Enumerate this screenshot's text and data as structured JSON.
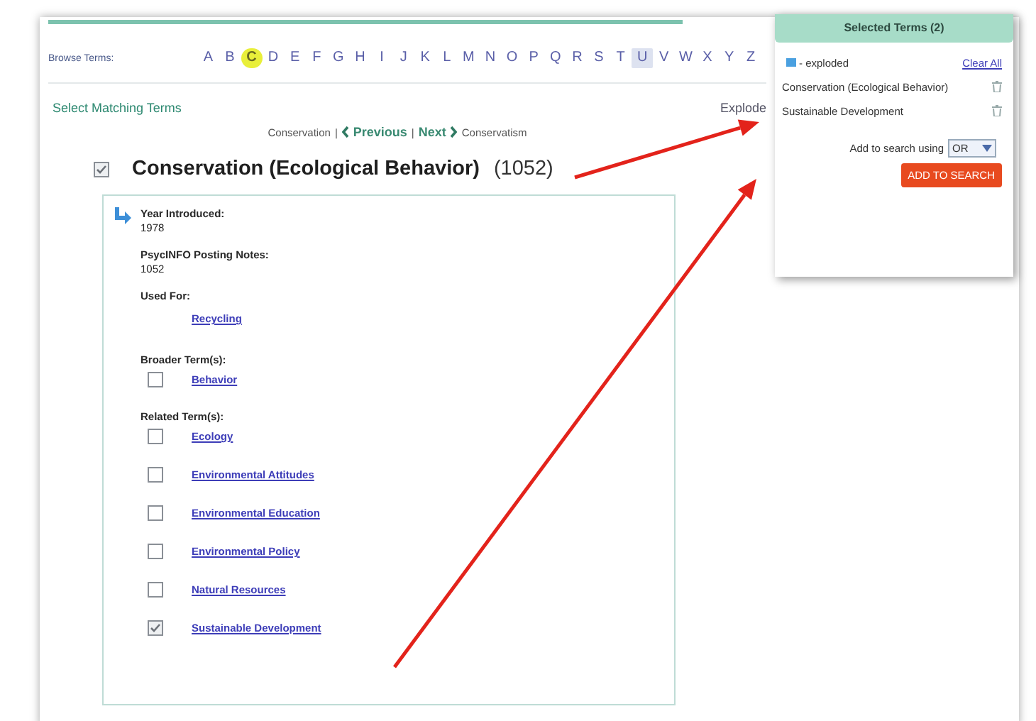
{
  "browse": {
    "label": "Browse Terms:",
    "letters": [
      {
        "letter": "A",
        "selected": false,
        "highlighted": false
      },
      {
        "letter": "B",
        "selected": false,
        "highlighted": false
      },
      {
        "letter": "C",
        "selected": true,
        "highlighted": false
      },
      {
        "letter": "D",
        "selected": false,
        "highlighted": false
      },
      {
        "letter": "E",
        "selected": false,
        "highlighted": false
      },
      {
        "letter": "F",
        "selected": false,
        "highlighted": false
      },
      {
        "letter": "G",
        "selected": false,
        "highlighted": false
      },
      {
        "letter": "H",
        "selected": false,
        "highlighted": false
      },
      {
        "letter": "I",
        "selected": false,
        "highlighted": false
      },
      {
        "letter": "J",
        "selected": false,
        "highlighted": false
      },
      {
        "letter": "K",
        "selected": false,
        "highlighted": false
      },
      {
        "letter": "L",
        "selected": false,
        "highlighted": false
      },
      {
        "letter": "M",
        "selected": false,
        "highlighted": false
      },
      {
        "letter": "N",
        "selected": false,
        "highlighted": false
      },
      {
        "letter": "O",
        "selected": false,
        "highlighted": false
      },
      {
        "letter": "P",
        "selected": false,
        "highlighted": false
      },
      {
        "letter": "Q",
        "selected": false,
        "highlighted": false
      },
      {
        "letter": "R",
        "selected": false,
        "highlighted": false
      },
      {
        "letter": "S",
        "selected": false,
        "highlighted": false
      },
      {
        "letter": "T",
        "selected": false,
        "highlighted": false
      },
      {
        "letter": "U",
        "selected": false,
        "highlighted": true
      },
      {
        "letter": "V",
        "selected": false,
        "highlighted": false
      },
      {
        "letter": "W",
        "selected": false,
        "highlighted": false
      },
      {
        "letter": "X",
        "selected": false,
        "highlighted": false
      },
      {
        "letter": "Y",
        "selected": false,
        "highlighted": false
      },
      {
        "letter": "Z",
        "selected": false,
        "highlighted": false
      }
    ]
  },
  "section_title": "Select Matching Terms",
  "explode_label": "Explode",
  "nav": {
    "before": "Conservation",
    "separators": [
      "|",
      "|"
    ],
    "previous": "Previous",
    "next": "Next",
    "after": "Conservatism"
  },
  "term": {
    "checked": true,
    "title": "Conservation (Ecological Behavior)",
    "count": "(1052)"
  },
  "details": {
    "year_label": "Year Introduced:",
    "year": "1978",
    "notes_label": "PsycINFO Posting Notes:",
    "notes": "1052",
    "used_for_label": "Used For:",
    "used_for": [
      "Recycling"
    ],
    "broader_label": "Broader Term(s):",
    "broader": [
      {
        "label": "Behavior",
        "checked": false
      }
    ],
    "related_label": "Related Term(s):",
    "related": [
      {
        "label": "Ecology",
        "checked": false
      },
      {
        "label": "Environmental Attitudes",
        "checked": false
      },
      {
        "label": "Environmental Education",
        "checked": false
      },
      {
        "label": "Environmental Policy",
        "checked": false
      },
      {
        "label": "Natural Resources",
        "checked": false
      },
      {
        "label": "Sustainable Development",
        "checked": true
      }
    ]
  },
  "selected_panel": {
    "title": "Selected Terms (2)",
    "legend": "- exploded",
    "clear": "Clear All",
    "terms": [
      "Conservation (Ecological Behavior)",
      "Sustainable Development"
    ],
    "add_label": "Add to search using",
    "operator": "OR",
    "button": "ADD TO SEARCH"
  }
}
